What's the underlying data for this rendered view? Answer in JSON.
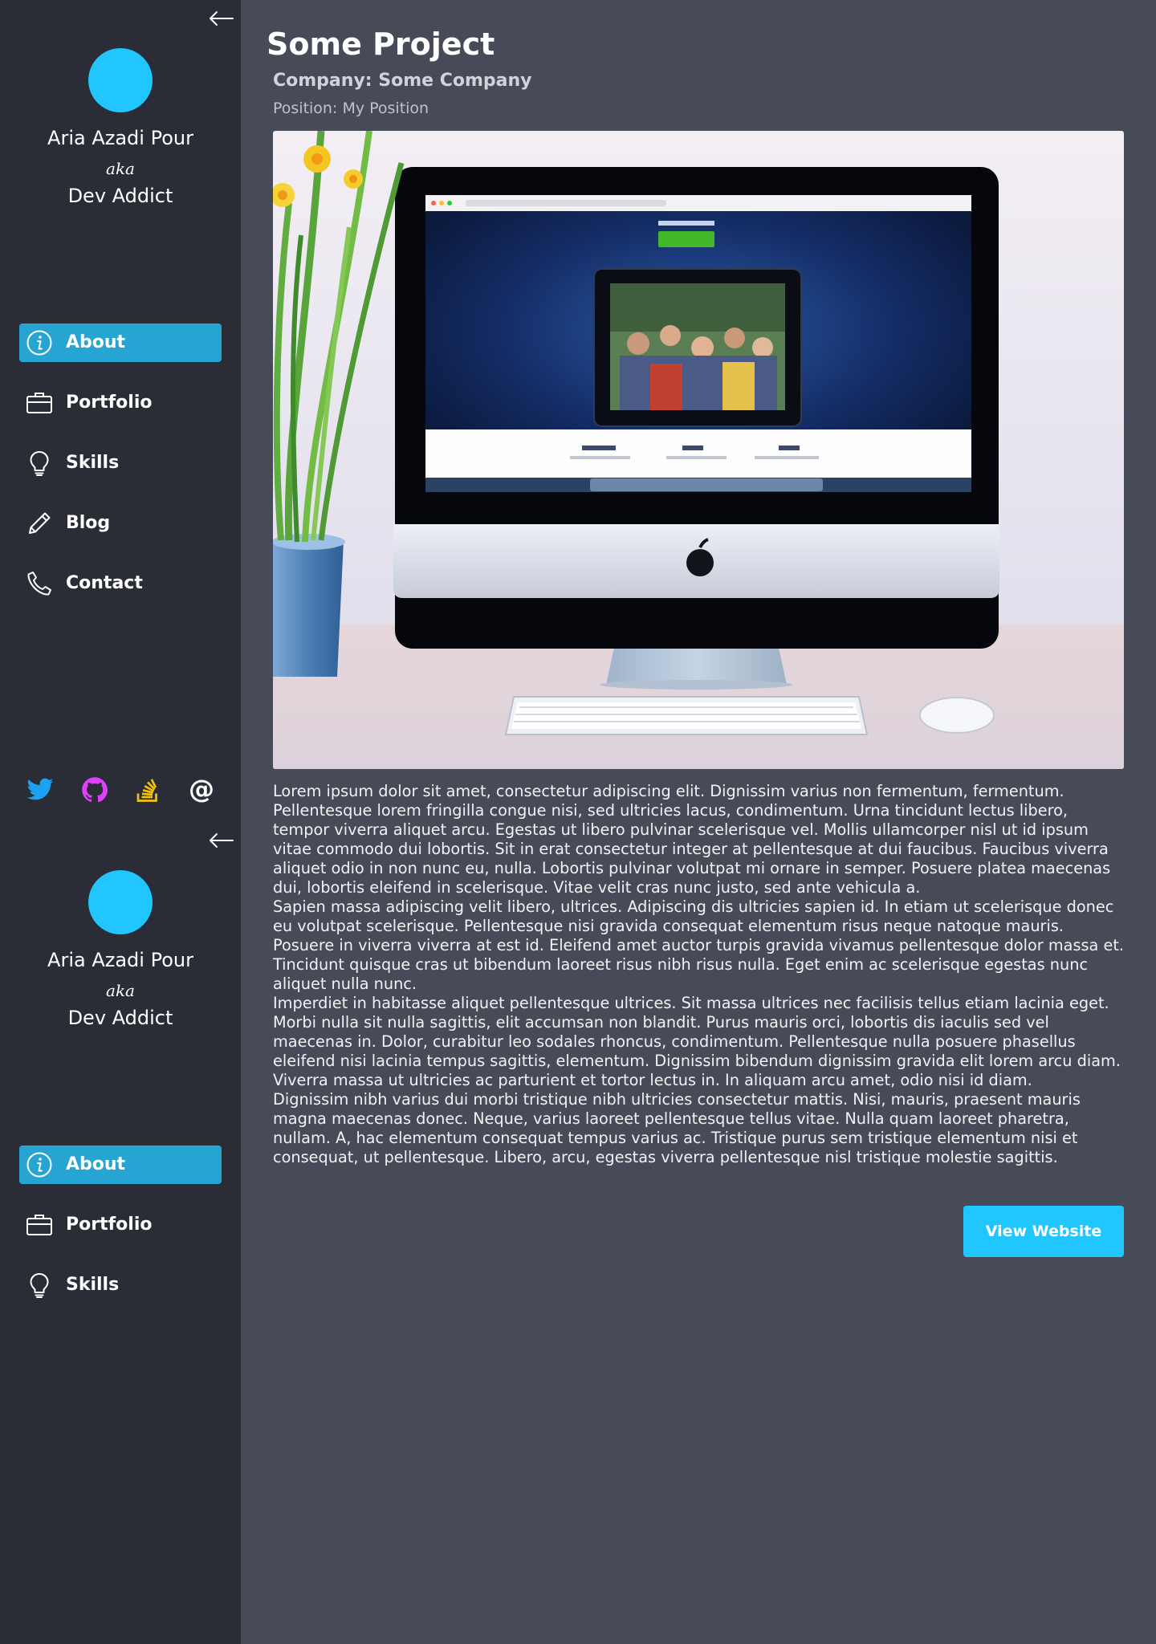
{
  "sidebar": {
    "profile": {
      "name": "Aria Azadi Pour",
      "aka": "aka",
      "alias": "Dev Addict"
    },
    "nav": [
      {
        "label": "About",
        "icon": "info-icon",
        "active": true
      },
      {
        "label": "Portfolio",
        "icon": "briefcase-icon",
        "active": false
      },
      {
        "label": "Skills",
        "icon": "lightbulb-icon",
        "active": false
      },
      {
        "label": "Blog",
        "icon": "pencil-icon",
        "active": false
      },
      {
        "label": "Contact",
        "icon": "phone-icon",
        "active": false
      }
    ],
    "socials": [
      {
        "icon": "twitter-icon",
        "color": "#1da1f2"
      },
      {
        "icon": "github-icon",
        "color": "#e040fb"
      },
      {
        "icon": "stackoverflow-icon",
        "color": "#f4c20d"
      },
      {
        "icon": "email-icon",
        "color": "#ffffff",
        "glyph": "@"
      }
    ],
    "collapse_icon": "arrow-left-icon"
  },
  "project": {
    "title": "Some Project",
    "company_label": "Company:",
    "company": "Some Company",
    "position_label": "Position:",
    "position": "My Position",
    "image_icon": "desktop-computer-photo",
    "description": [
      "Lorem ipsum dolor sit amet, consectetur adipiscing elit. Dignissim varius non fermentum, fermentum. Pellentesque lorem fringilla congue nisi, sed ultricies lacus, condimentum. Urna tincidunt lectus libero, tempor viverra aliquet arcu. Egestas ut libero pulvinar scelerisque vel. Mollis ullamcorper nisl ut id ipsum vitae commodo dui lobortis. Sit in erat consectetur integer at pellentesque at dui faucibus. Faucibus viverra aliquet odio in non nunc eu, nulla. Lobortis pulvinar volutpat mi ornare in semper. Posuere platea maecenas dui, lobortis eleifend in scelerisque. Vitae velit cras nunc justo, sed ante vehicula a.",
      "Sapien massa adipiscing velit libero, ultrices. Adipiscing dis ultricies sapien id. In etiam ut scelerisque donec eu volutpat scelerisque. Pellentesque nisi gravida consequat elementum risus neque natoque mauris. Posuere in viverra viverra at est id. Eleifend amet auctor turpis gravida vivamus pellentesque dolor massa et. Tincidunt quisque cras ut bibendum laoreet risus nibh risus nulla. Eget enim ac scelerisque egestas nunc aliquet nulla nunc.",
      "Imperdiet in habitasse aliquet pellentesque ultrices. Sit massa ultrices nec facilisis tellus etiam lacinia eget. Morbi nulla sit nulla sagittis, elit accumsan non blandit. Purus mauris orci, lobortis dis iaculis sed vel maecenas in. Dolor, curabitur leo sodales rhoncus, condimentum. Pellentesque nulla posuere phasellus eleifend nisi lacinia tempus sagittis, elementum. Dignissim bibendum dignissim gravida elit lorem arcu diam. Viverra massa ut ultricies ac parturient et tortor lectus in. In aliquam arcu amet, odio nisi id diam.",
      "Dignissim nibh varius dui morbi tristique nibh ultricies consectetur mattis. Nisi, mauris, praesent mauris magna maecenas donec. Neque, varius laoreet pellentesque tellus vitae. Nulla quam laoreet pharetra, nullam. A, hac elementum consequat tempus varius ac. Tristique purus sem tristique elementum nisi et consequat, ut pellentesque. Libero, arcu, egestas viverra pellentesque nisl tristique molestie sagittis."
    ],
    "cta_label": "View Website"
  },
  "colors": {
    "accent": "#22c6ff",
    "nav_active": "#26a5d3",
    "sidebar_bg": "#2a2d36",
    "main_bg": "#474b57"
  }
}
